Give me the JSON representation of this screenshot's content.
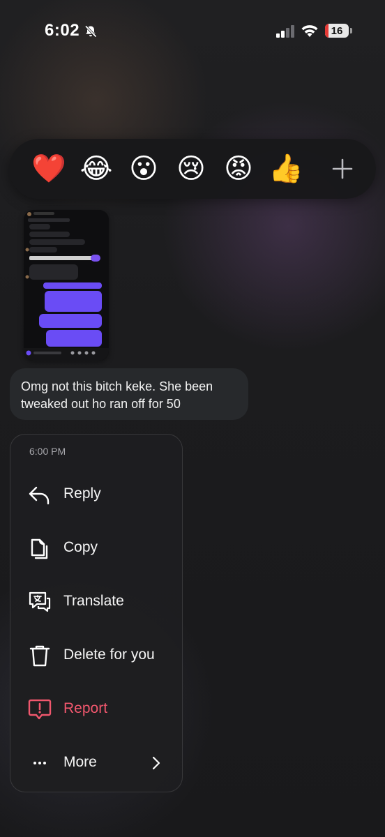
{
  "status_bar": {
    "time": "6:02",
    "battery_level": "16",
    "battery_percent": 16
  },
  "reactions": [
    {
      "emoji": "❤️",
      "name": "red-heart"
    },
    {
      "emoji": "😂",
      "name": "face-with-tears-of-joy"
    },
    {
      "emoji": "😮",
      "name": "face-with-open-mouth"
    },
    {
      "emoji": "😢",
      "name": "crying-face"
    },
    {
      "emoji": "😡",
      "name": "pouting-face"
    },
    {
      "emoji": "👍",
      "name": "thumbs-up"
    }
  ],
  "add_reaction_icon": "plus-icon",
  "message": {
    "text": "Omg not this bitch keke. She been tweaked out ho ran off for 50"
  },
  "menu": {
    "timestamp": "6:00 PM",
    "items": [
      {
        "label": "Reply",
        "icon": "reply-arrow-icon"
      },
      {
        "label": "Copy",
        "icon": "copy-icon"
      },
      {
        "label": "Translate",
        "icon": "translate-icon"
      },
      {
        "label": "Delete for you",
        "icon": "trash-icon"
      },
      {
        "label": "Report",
        "icon": "report-icon",
        "color": "#f0576d"
      },
      {
        "label": "More",
        "icon": "more-dots-icon"
      }
    ]
  },
  "colors": {
    "background": "#1c1c1e",
    "report": "#f0576d",
    "outgoing_bubble": "#6a4cf5"
  }
}
